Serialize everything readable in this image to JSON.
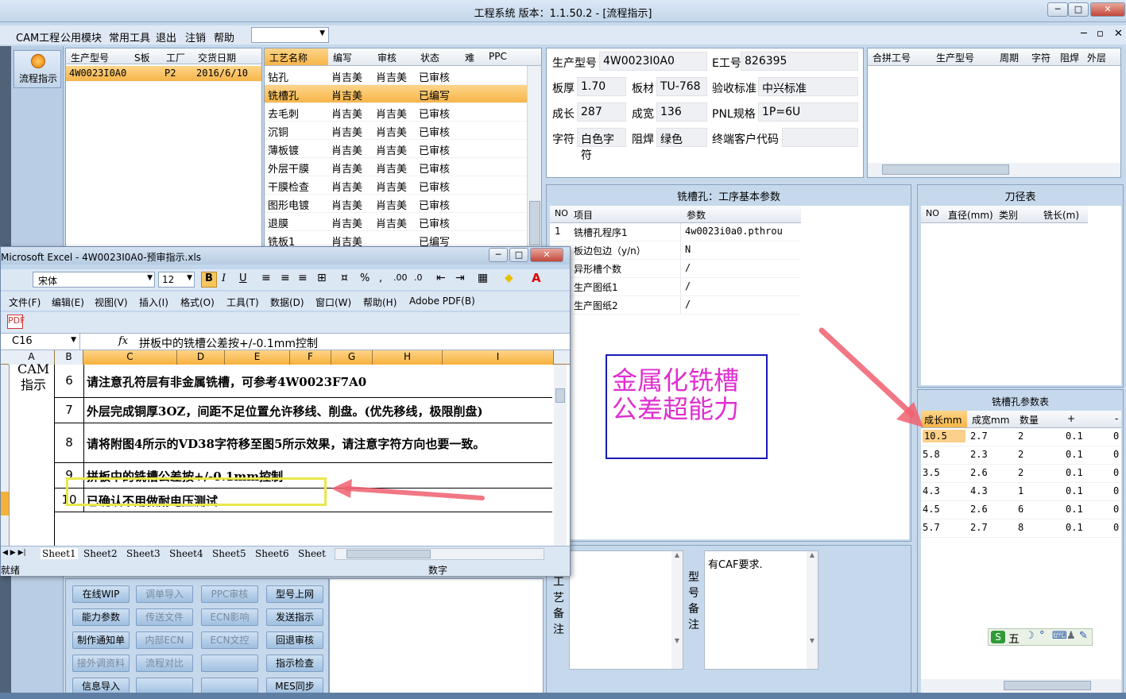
{
  "window": {
    "title": "工程系统  版本：1.1.50.2 - [流程指示]"
  },
  "menu": {
    "items": [
      "CAM工程",
      "公用模块",
      "常用工具",
      "退出",
      "注销",
      "帮助"
    ]
  },
  "toolbar": {
    "flow_label": "流程指示"
  },
  "order_list": {
    "headers": [
      "生产型号",
      "S板",
      "工厂",
      "交货日期"
    ],
    "rows": [
      [
        "4W0023I0A0",
        "",
        "P2",
        "2016/6/10"
      ]
    ]
  },
  "process_list": {
    "headers": [
      "工艺名称",
      "编写",
      "审核",
      "状态",
      "难",
      "PPC"
    ],
    "rows": [
      [
        "钻孔",
        "肖吉美",
        "肖吉美",
        "已审核"
      ],
      [
        "铣槽孔",
        "肖吉美",
        "",
        "已编写"
      ],
      [
        "去毛刺",
        "肖吉美",
        "肖吉美",
        "已审核"
      ],
      [
        "沉铜",
        "肖吉美",
        "肖吉美",
        "已审核"
      ],
      [
        "薄板镀",
        "肖吉美",
        "肖吉美",
        "已审核"
      ],
      [
        "外层干膜",
        "肖吉美",
        "肖吉美",
        "已审核"
      ],
      [
        "干膜检查",
        "肖吉美",
        "肖吉美",
        "已审核"
      ],
      [
        "图形电镀",
        "肖吉美",
        "肖吉美",
        "已审核"
      ],
      [
        "退膜",
        "肖吉美",
        "肖吉美",
        "已审核"
      ],
      [
        "铣板1",
        "肖吉美",
        "",
        "已编写"
      ]
    ]
  },
  "info": {
    "model_label": "生产型号",
    "model": "4W0023I0A0",
    "e_label": "E工号",
    "e_no": "826395",
    "thick_label": "板厚",
    "thick": "1.70",
    "mat_label": "板材",
    "mat": "TU-768",
    "std_label": "验收标准",
    "std": "中兴标准",
    "len_label": "成长",
    "len": "287",
    "wid_label": "成宽",
    "wid": "136",
    "pnl_label": "PNL规格",
    "pnl": "1P=6U",
    "char_label": "字符",
    "char": "白色字符",
    "mask_label": "阻焊",
    "mask": "绿色",
    "cust_label": "终端客户代码",
    "cust": ""
  },
  "combine": {
    "headers": [
      "合拼工号",
      "生产型号",
      "周期",
      "字符",
      "阻焊",
      "外层"
    ]
  },
  "params": {
    "title": "铣槽孔：工序基本参数",
    "headers": [
      "NO",
      "项目",
      "参数"
    ],
    "rows": [
      [
        "1",
        "铣槽孔程序1",
        "4w0023i0a0.pthrou"
      ],
      [
        "",
        "板边包边（y/n）",
        "N"
      ],
      [
        "",
        "异形槽个数",
        "/"
      ],
      [
        "",
        "生产图纸1",
        "/"
      ],
      [
        "",
        "生产图纸2",
        "/"
      ]
    ]
  },
  "note_box": {
    "line1": "金属化铣槽",
    "line2": "公差超能力"
  },
  "tool_table": {
    "title": "刀径表",
    "headers": [
      "NO",
      "直径(mm)",
      "类别",
      "铣长(m)"
    ]
  },
  "slot_table": {
    "title": "铣槽孔参数表",
    "headers": [
      "成长mm",
      "成宽mm",
      "数量",
      "+",
      "-"
    ],
    "rows": [
      [
        "10.5",
        "2.7",
        "2",
        "0.1",
        "0."
      ],
      [
        "5.8",
        "2.3",
        "2",
        "0.1",
        "0."
      ],
      [
        "3.5",
        "2.6",
        "2",
        "0.1",
        "0."
      ],
      [
        "4.3",
        "4.3",
        "1",
        "0.1",
        "0."
      ],
      [
        "4.5",
        "2.6",
        "6",
        "0.1",
        "0."
      ],
      [
        "5.7",
        "2.7",
        "8",
        "0.1",
        "0."
      ]
    ]
  },
  "remarks": {
    "craft_label": "工艺备注",
    "model_label": "型号备注",
    "model_text": "有CAF要求."
  },
  "buttons": [
    [
      "在线WIP",
      "调单导入",
      "PPC审核",
      "型号上网"
    ],
    [
      "能力参数",
      "传送文件",
      "ECN影响",
      "发送指示"
    ],
    [
      "制作通知单",
      "内部ECN",
      "ECN文控",
      "回退审核"
    ],
    [
      "接外调资料",
      "流程对比",
      "",
      "指示检查"
    ],
    [
      "信息导入",
      "",
      "",
      "MES同步"
    ]
  ],
  "ime": {
    "label": "五"
  },
  "excel": {
    "title": "Microsoft Excel - 4W0023I0A0-预审指示.xls",
    "font": "宋体",
    "size": "12",
    "menu": [
      "文件(F)",
      "编辑(E)",
      "视图(V)",
      "插入(I)",
      "格式(O)",
      "工具(T)",
      "数据(D)",
      "窗口(W)",
      "帮助(H)",
      "Adobe PDF(B)"
    ],
    "namebox": "C16",
    "formula": "拼板中的铣槽公差按+/-0.1mm控制",
    "columns": [
      "A",
      "B",
      "C",
      "D",
      "E",
      "F",
      "G",
      "H",
      "I"
    ],
    "colA_text": "CAM指示",
    "rows": [
      {
        "n": "6",
        "text": "请注意孔符层有非金属铣槽，可参考4W0023F7A0"
      },
      {
        "n": "7",
        "text": "外层完成铜厚3OZ，间距不足位置允许移线、削盘。(优先移线，极限削盘)"
      },
      {
        "n": "8",
        "text": "请将附图4所示的VD38字符移至图5所示效果，请注意字符方向也要一致。"
      },
      {
        "n": "9",
        "text": "拼板中的铣槽公差按+/-0.1mm控制"
      },
      {
        "n": "10",
        "text": "已确认不用做耐电压测试"
      }
    ],
    "sheets": [
      "Sheet1",
      "Sheet2",
      "Sheet3",
      "Sheet4",
      "Sheet5",
      "Sheet6",
      "Sheet"
    ],
    "status": "就绪",
    "status_num": "数字"
  }
}
